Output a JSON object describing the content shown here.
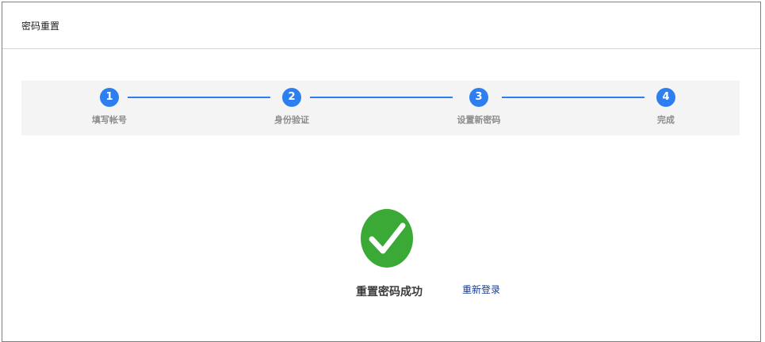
{
  "header": {
    "title": "密码重置"
  },
  "steps": [
    {
      "number": "1",
      "label": "填写帐号"
    },
    {
      "number": "2",
      "label": "身份验证"
    },
    {
      "number": "3",
      "label": "设置新密码"
    },
    {
      "number": "4",
      "label": "完成"
    }
  ],
  "result": {
    "message": "重置密码成功",
    "relogin_label": "重新登录"
  },
  "colors": {
    "accent": "#2d7fef",
    "success": "#3aa935",
    "link": "#1a3d8f"
  },
  "icons": {
    "success": "checkmark-icon"
  }
}
